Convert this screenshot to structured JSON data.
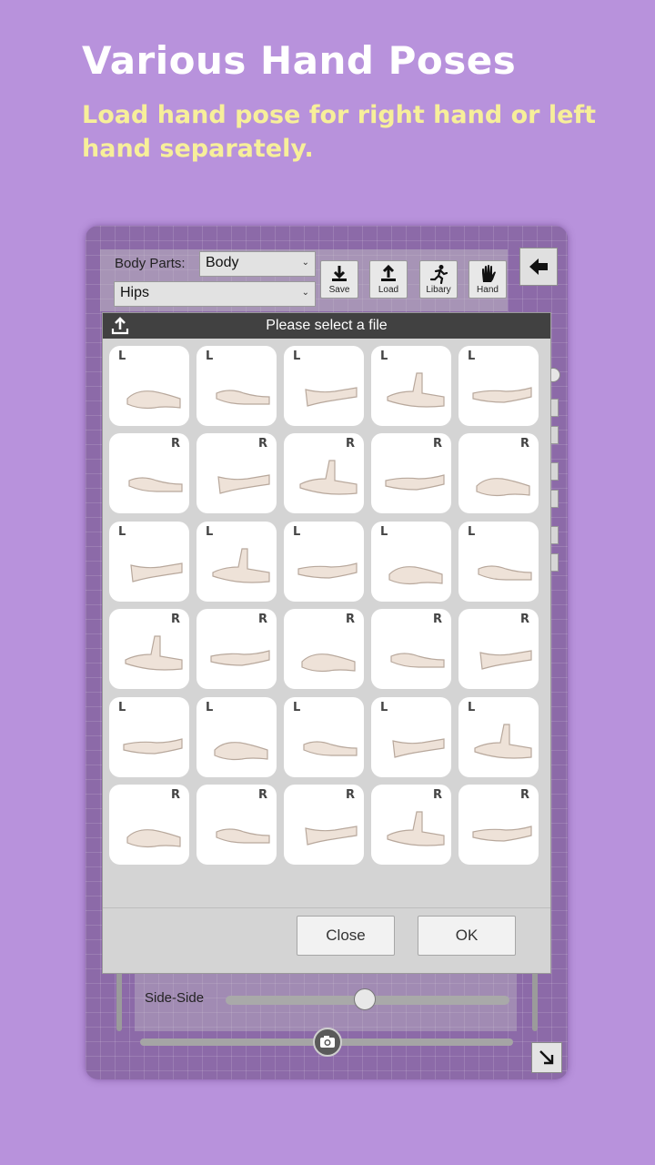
{
  "promo": {
    "title": "Various Hand Poses",
    "subtitle": "Load hand pose for right hand or left hand separately."
  },
  "toolbar": {
    "body_parts_label": "Body Parts:",
    "body_parts_value": "Body",
    "part_value": "Hips",
    "buttons": [
      {
        "label": "Save",
        "icon": "download-icon"
      },
      {
        "label": "Load",
        "icon": "upload-icon"
      },
      {
        "label": "Libary",
        "icon": "running-person-icon"
      },
      {
        "label": "Hand",
        "icon": "hand-icon"
      }
    ],
    "back_icon": "back-arrow-icon"
  },
  "dialog": {
    "title": "Please select a file",
    "close_label": "Close",
    "ok_label": "OK",
    "tiles": [
      {
        "side": "L"
      },
      {
        "side": "L"
      },
      {
        "side": "L"
      },
      {
        "side": "L"
      },
      {
        "side": "L"
      },
      {
        "side": "R"
      },
      {
        "side": "R"
      },
      {
        "side": "R"
      },
      {
        "side": "R"
      },
      {
        "side": "R"
      },
      {
        "side": "L"
      },
      {
        "side": "L"
      },
      {
        "side": "L"
      },
      {
        "side": "L"
      },
      {
        "side": "L"
      },
      {
        "side": "R"
      },
      {
        "side": "R"
      },
      {
        "side": "R"
      },
      {
        "side": "R"
      },
      {
        "side": "R"
      },
      {
        "side": "L"
      },
      {
        "side": "L"
      },
      {
        "side": "L"
      },
      {
        "side": "L"
      },
      {
        "side": "L"
      },
      {
        "side": "R"
      },
      {
        "side": "R"
      },
      {
        "side": "R"
      },
      {
        "side": "R"
      },
      {
        "side": "R"
      }
    ]
  },
  "bottom": {
    "slider_label": "Side-Side",
    "slider_value": 0.49
  },
  "colors": {
    "background": "#b892dc",
    "subtitle": "#f7ef9a",
    "dialog_header": "#414141"
  }
}
